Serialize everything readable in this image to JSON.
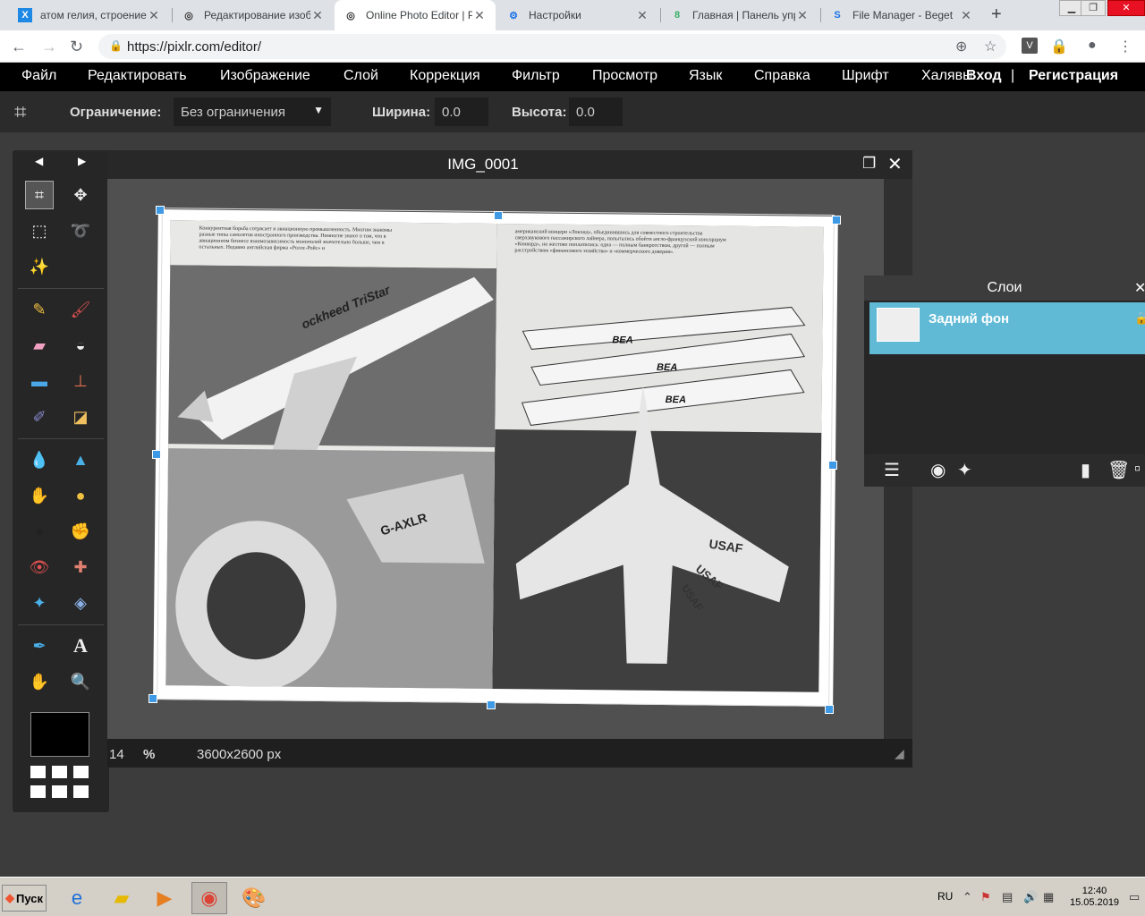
{
  "browser": {
    "tabs": [
      {
        "title": "атом гелия, строение я",
        "icon": "X"
      },
      {
        "title": "Редактирование изобр",
        "icon": "◎"
      },
      {
        "title": "Online Photo Editor | Pi",
        "icon": "◎"
      },
      {
        "title": "Настройки",
        "icon": "⚙"
      },
      {
        "title": "Главная | Панель упра",
        "icon": "8"
      },
      {
        "title": "File Manager - Beget",
        "icon": "S"
      }
    ],
    "new_tab": "+",
    "url": "https://pixlr.com/editor/",
    "profile_initial": "V"
  },
  "menu": {
    "items": [
      "Файл",
      "Редактировать",
      "Изображение",
      "Слой",
      "Коррекция",
      "Фильтр",
      "Просмотр",
      "Язык",
      "Справка",
      "Шрифт",
      "Халявы"
    ],
    "login": "Вход",
    "divider": "|",
    "register": "Регистрация"
  },
  "tool_options": {
    "constraint_label": "Ограничение:",
    "constraint_value": "Без ограничения",
    "width_label": "Ширина:",
    "width_value": "0.0",
    "height_label": "Высота:",
    "height_value": "0.0"
  },
  "document": {
    "title": "IMG_0001",
    "zoom": "14",
    "zoom_unit": "%",
    "dimensions": "3600x2600 px"
  },
  "photo": {
    "left_text": "Конкурентная борьба сотрясает и авиационную промышленность. Многим знакомы разные типы самолетов иностранного производства. Немногие знают о том, что в авиационном бизнесе взаимозависимость монополий значительно больше, чем в остальных. Недавно английская фирма «Роллс-Ройс» и",
    "right_text": "американский концерн «Локхид», объединившись для совместного строительства сверхзвукового пассажирского лайнера, попытались обойти англо-французский консорциум «Конкорд», но жестоко поплатились: одна — полным банкротством, другой — полным расстройством «финансового хозяйства» и «коммерческого доверия».",
    "plane_text_1": "ockheed TriStar",
    "plane_text_2": "G-AXLR",
    "bea_1": "BEA",
    "bea_2": "BEA",
    "bea_3": "BEA",
    "usaf_1": "USAF",
    "usaf_2": "USAF",
    "usaf_3": "USAF"
  },
  "layers": {
    "title": "Слои",
    "items": [
      {
        "name": "Задний фон"
      }
    ]
  },
  "taskbar": {
    "start": "Пуск",
    "lang": "RU",
    "time": "12:40",
    "date": "15.05.2019"
  }
}
